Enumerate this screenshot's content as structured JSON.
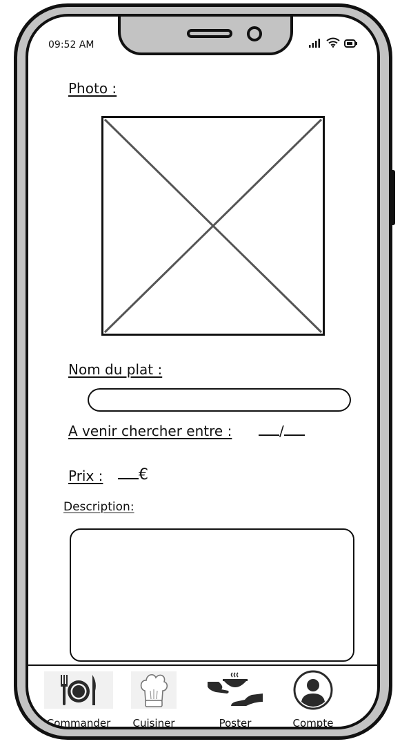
{
  "status_bar": {
    "time": "09:52 AM"
  },
  "form": {
    "photo_label": "Photo :",
    "dish_name_label": "Nom du plat :",
    "dish_name_value": "",
    "pickup_label": "A venir chercher entre :",
    "pickup_separator": "/",
    "price_label": "Prix :",
    "price_currency": "€",
    "description_label": "Description:"
  },
  "nav": {
    "items": [
      {
        "label": "Commander",
        "icon": "plate-cutlery-icon"
      },
      {
        "label": "Cuisiner",
        "icon": "chef-hat-icon"
      },
      {
        "label": "Poster",
        "icon": "serving-hands-icon"
      },
      {
        "label": "Compte",
        "icon": "user-icon"
      }
    ]
  },
  "colors": {
    "frame": "#c3c3c3",
    "outline": "#111111",
    "screen": "#ffffff",
    "placeholder_line": "#555555"
  }
}
